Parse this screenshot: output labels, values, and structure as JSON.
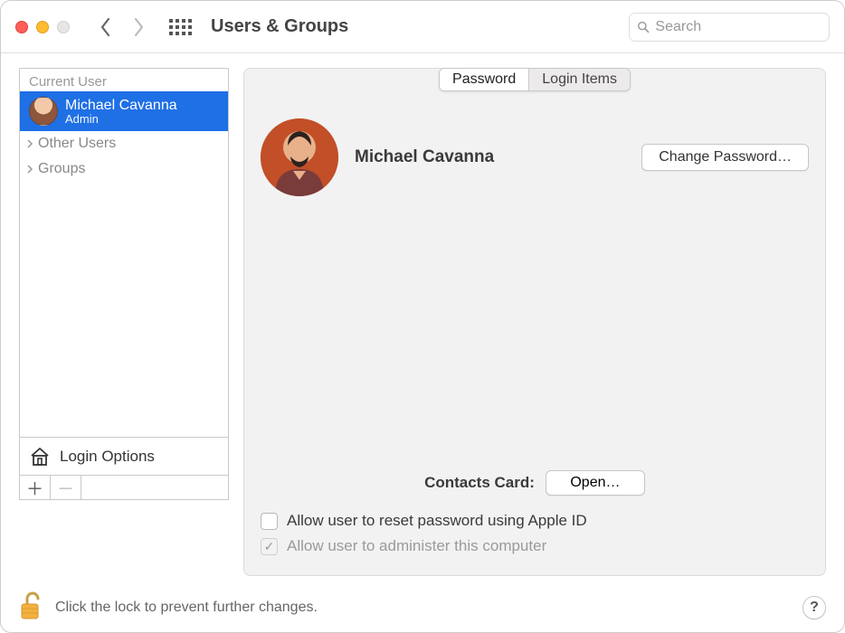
{
  "window": {
    "title": "Users & Groups"
  },
  "search": {
    "placeholder": "Search"
  },
  "sidebar": {
    "current_user_heading": "Current User",
    "current_user": {
      "name": "Michael Cavanna",
      "role": "Admin"
    },
    "other_users_label": "Other Users",
    "groups_label": "Groups",
    "login_options_label": "Login Options"
  },
  "tabs": {
    "password": "Password",
    "login_items": "Login Items"
  },
  "main": {
    "username": "Michael Cavanna",
    "change_password_label": "Change Password…",
    "contacts_card_label": "Contacts Card:",
    "open_label": "Open…",
    "allow_reset_label": "Allow user to reset password using Apple ID",
    "allow_admin_label": "Allow user to administer this computer"
  },
  "footer": {
    "lock_text": "Click the lock to prevent further changes.",
    "help_label": "?"
  }
}
